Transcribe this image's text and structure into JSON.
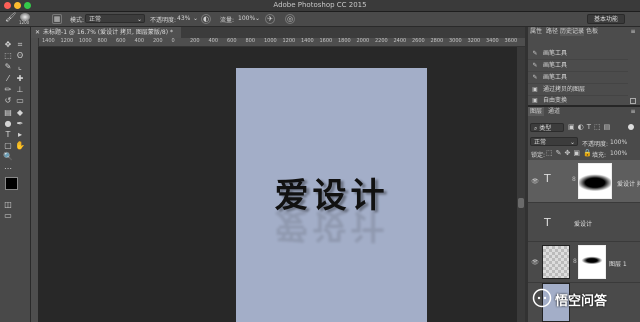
{
  "titlebar": {
    "title": "Adobe Photoshop CC 2015",
    "colors": {
      "close": "#fc5f57",
      "minimize": "#fdbc2e",
      "maximize": "#34c84a"
    }
  },
  "options_bar": {
    "brush_size": "1200",
    "mode_label": "模式:",
    "mode_value": "正常",
    "opacity_label": "不透明度:",
    "opacity_value": "43%",
    "flow_label": "流量:",
    "flow_value": "100%",
    "workspace_button": "基本功能"
  },
  "document": {
    "tab_title": "未标题-1 @ 16.7% (爱设计 拷贝, 图层蒙版/8) *",
    "text": "爱设计",
    "background_color": "#a3aec8"
  },
  "ruler": {
    "ticks": [
      "1400",
      "1200",
      "1000",
      "800",
      "600",
      "400",
      "200",
      "0",
      "200",
      "400",
      "600",
      "800",
      "1000",
      "1200",
      "1400",
      "1600",
      "1800",
      "2000",
      "2200",
      "2400",
      "2600",
      "2800",
      "3000",
      "3200",
      "3400",
      "3600"
    ]
  },
  "panels": {
    "top_tabs": [
      "属性",
      "路径",
      "历史记录",
      "色板"
    ],
    "history": [
      "画笔工具",
      "画笔工具",
      "画笔工具",
      "通过拷贝的图层",
      "自由变换"
    ],
    "layer_tabs": [
      "图层",
      "通道"
    ],
    "kind_label": "类型",
    "blend_mode": "正常",
    "opacity_label": "不透明度:",
    "opacity_value": "100%",
    "lock_label": "锁定:",
    "fill_label": "填充:",
    "fill_value": "100%",
    "layers": [
      {
        "name": "爱设计 拷贝"
      },
      {
        "name": "爱设计"
      },
      {
        "name": "图层 1"
      }
    ]
  },
  "watermark": {
    "text": "悟空问答"
  }
}
